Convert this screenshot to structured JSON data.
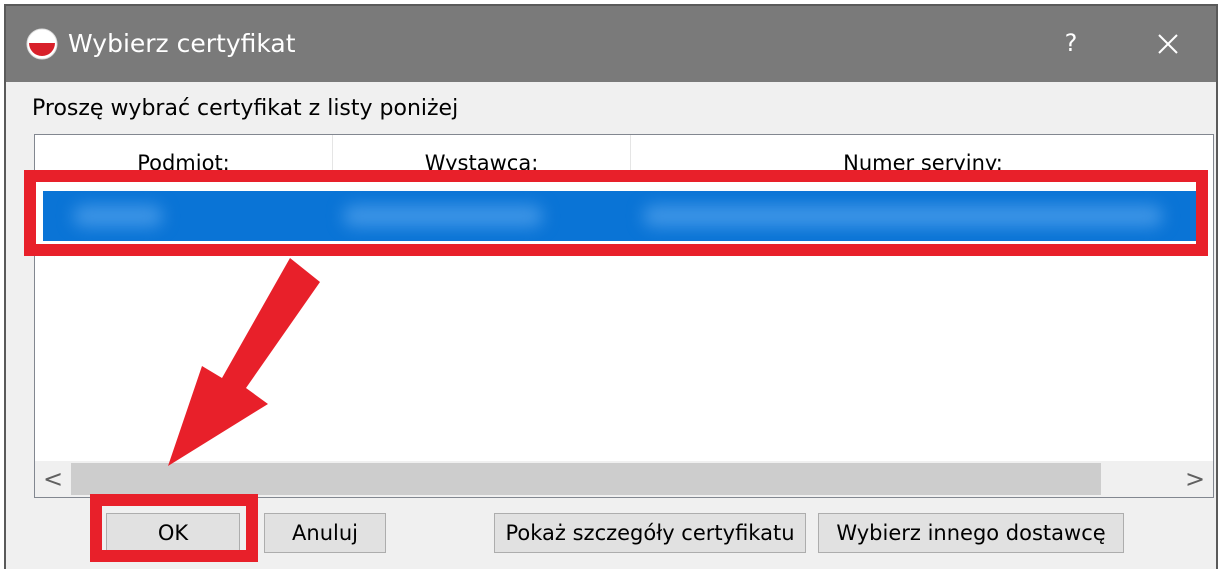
{
  "window": {
    "title": "Wybierz certyfikat",
    "help_label": "?",
    "title_icon": "app-icon",
    "close_icon": "close-icon"
  },
  "instruction": "Proszę wybrać certyfikat z listy poniżej",
  "columns": [
    "Podmiot:",
    "Wystawca:",
    "Numer seryjny:"
  ],
  "selected_row": {
    "state": "selected",
    "content": "redacted"
  },
  "scrollbar": {
    "left_label": "<",
    "right_label": ">"
  },
  "buttons": {
    "ok": "OK",
    "cancel": "Anuluj",
    "details": "Pokaż szczegóły certyfikatu",
    "provider": "Wybierz innego dostawcę"
  },
  "colors": {
    "selection": "#0a74d6",
    "annotation": "#e8202a",
    "titlebar": "#7a7a7a"
  }
}
